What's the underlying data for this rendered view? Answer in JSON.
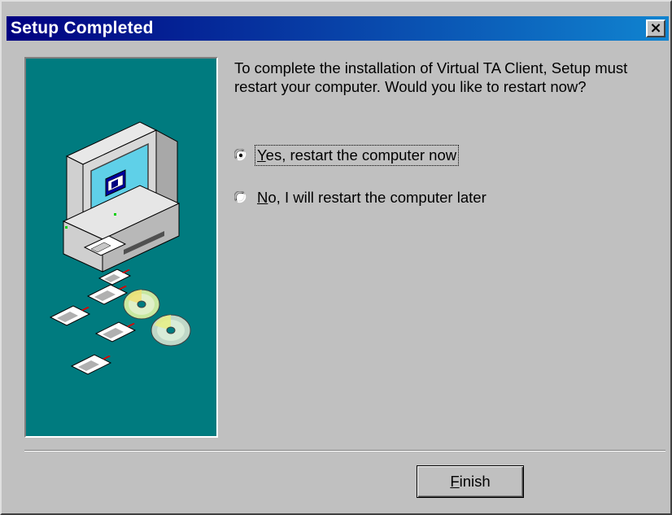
{
  "window": {
    "title": "Setup Completed",
    "close_symbol": "×"
  },
  "message": {
    "text": "To complete the installation of Virtual TA Client, Setup must restart your computer. Would you like to restart now?"
  },
  "options": {
    "yes": {
      "accel": "Y",
      "rest": "es, restart the computer now",
      "selected": true
    },
    "no": {
      "accel": "N",
      "rest": "o, I will restart the computer later",
      "selected": false
    }
  },
  "buttons": {
    "finish": {
      "accel": "F",
      "rest": "inish"
    }
  },
  "illustration": {
    "icon": "computer-with-disks-illustration"
  },
  "colors": {
    "title_start": "#000080",
    "title_end": "#1084d0",
    "panel": "#007b7f",
    "face": "#c0c0c0"
  }
}
